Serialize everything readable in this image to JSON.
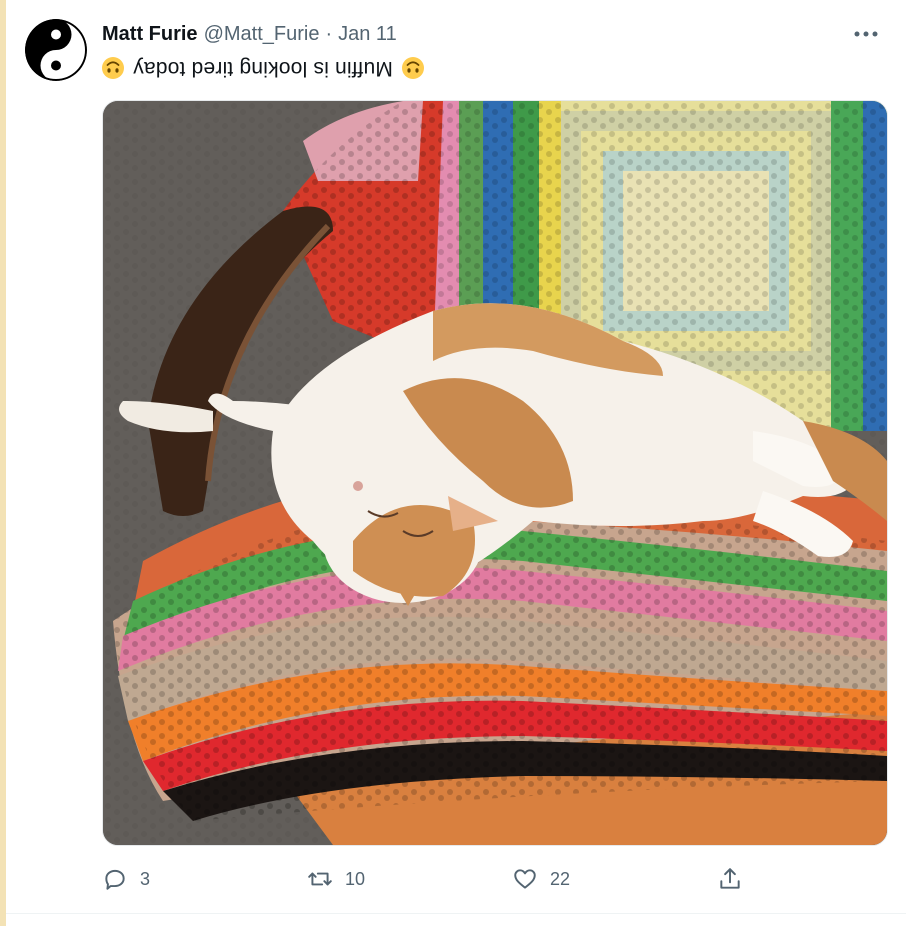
{
  "tweet": {
    "author_name": "Matt Furie",
    "handle": "@Matt_Furie",
    "separator": "·",
    "date": "Jan 11",
    "text": "Muffin is looking tired today",
    "emoji_left": "upside-down-face",
    "emoji_right": "upside-down-face",
    "avatar_icon": "yin-yang-icon",
    "more_icon": "more-horizontal-icon",
    "media_description": ""
  },
  "actions": {
    "reply_count": "3",
    "retweet_count": "10",
    "like_count": "22",
    "reply_icon": "reply-icon",
    "retweet_icon": "retweet-icon",
    "like_icon": "heart-icon",
    "share_icon": "share-icon"
  },
  "colors": {
    "accent": "#1d9bf0",
    "muted": "#536471",
    "text": "#0f1419",
    "emoji": "#ffcc4d"
  }
}
